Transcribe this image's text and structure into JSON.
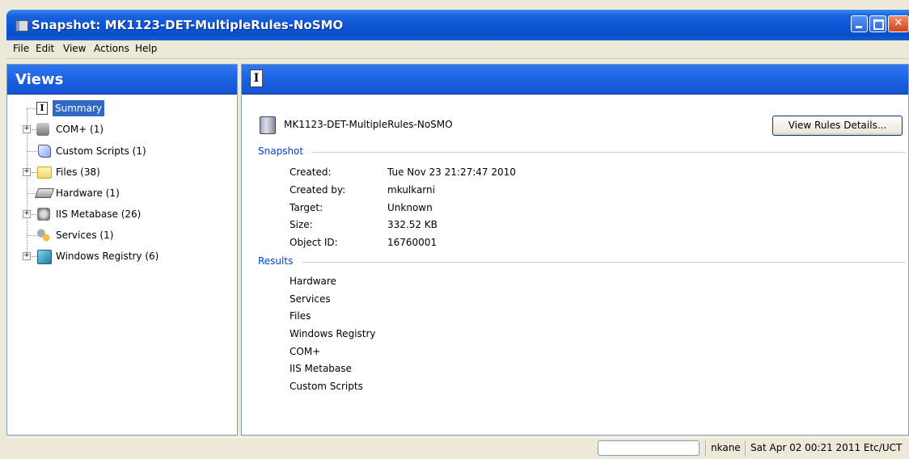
{
  "window": {
    "title": "Snapshot: MK1123-DET-MultipleRules-NoSMO",
    "minimize_icon": "minimize-icon",
    "maximize_icon": "maximize-icon",
    "close_icon": "close-icon"
  },
  "menu": [
    "File",
    "Edit",
    "View",
    "Actions",
    "Help"
  ],
  "views": {
    "title": "Views",
    "tree": [
      {
        "label": "Summary",
        "icon": "info-icon",
        "expandable": false,
        "selected": true
      },
      {
        "label": "COM+ (1)",
        "icon": "com-icon",
        "expandable": true
      },
      {
        "label": "Custom Scripts (1)",
        "icon": "script-icon",
        "expandable": false
      },
      {
        "label": "Files (38)",
        "icon": "folder-icon",
        "expandable": true
      },
      {
        "label": "Hardware (1)",
        "icon": "hardware-icon",
        "expandable": false
      },
      {
        "label": "IIS Metabase (26)",
        "icon": "metabase-icon",
        "expandable": true
      },
      {
        "label": "Services (1)",
        "icon": "services-icon",
        "expandable": false
      },
      {
        "label": "Windows Registry (6)",
        "icon": "registry-icon",
        "expandable": true
      }
    ]
  },
  "summary": {
    "header_icon": "info-icon",
    "snapshot_name": "MK1123-DET-MultipleRules-NoSMO",
    "view_rules_button": "View Rules Details...",
    "snapshot_section": "Snapshot",
    "properties": [
      {
        "label": "Created:",
        "value": "Tue Nov 23 21:27:47 2010"
      },
      {
        "label": "Created by:",
        "value": "mkulkarni"
      },
      {
        "label": "Target:",
        "value": "Unknown"
      },
      {
        "label": "Size:",
        "value": "332.52 KB"
      },
      {
        "label": "Object ID:",
        "value": "16760001"
      }
    ],
    "results_section": "Results",
    "results": [
      "Hardware",
      "Services",
      "Files",
      "Windows Registry",
      "COM+",
      "IIS Metabase",
      "Custom Scripts"
    ]
  },
  "status": {
    "field_value": "",
    "user": "nkane",
    "timestamp": "Sat Apr 02 00:21 2011 Etc/UCT"
  },
  "colors": {
    "header_blue": "#1a5ee0",
    "section_blue": "#0046d5",
    "selection": "#316ac5"
  }
}
